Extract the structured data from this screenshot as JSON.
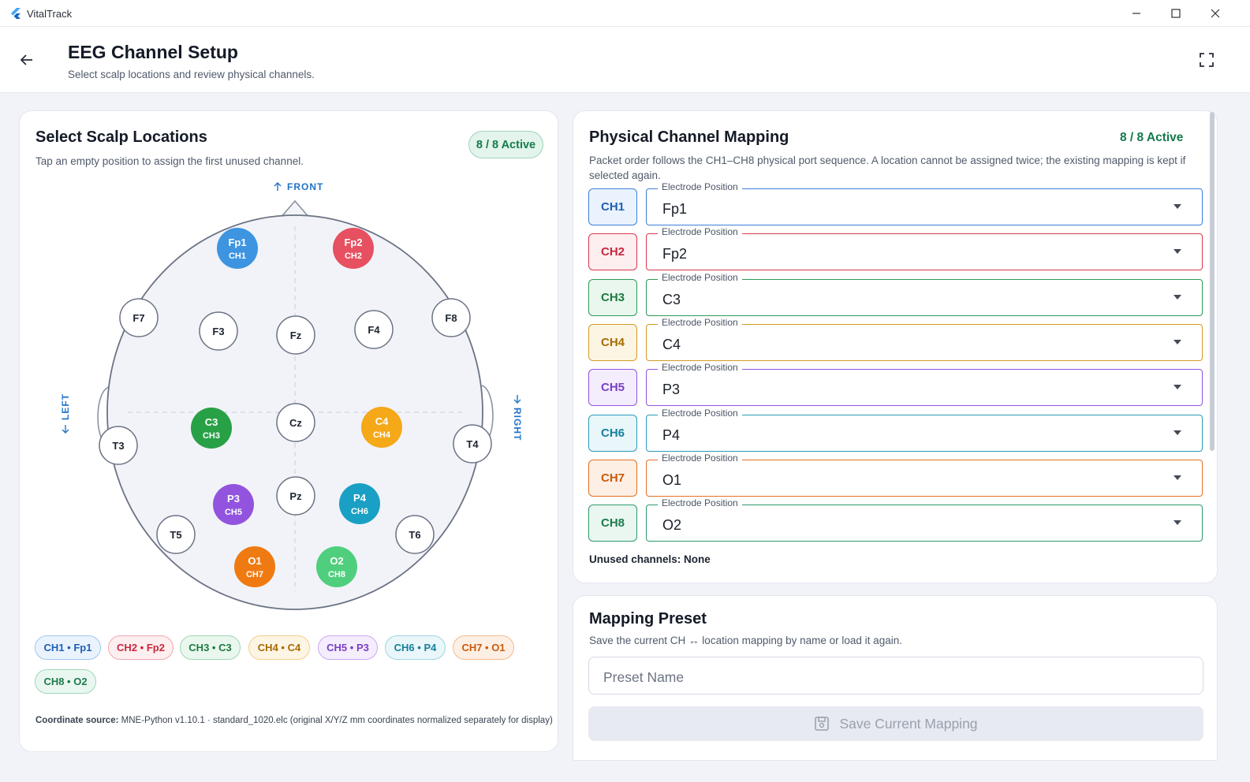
{
  "window": {
    "app_name": "VitalTrack"
  },
  "header": {
    "title": "EEG Channel Setup",
    "subtitle": "Select scalp locations and review physical channels."
  },
  "scalp": {
    "title": "Select Scalp Locations",
    "description": "Tap an empty position to assign the first unused channel.",
    "badge": "8 / 8 Active",
    "front_label": "FRONT",
    "left_label": "LEFT",
    "right_label": "RIGHT",
    "electrodes": [
      {
        "label": "Fp1",
        "channel": "CH1",
        "color": "#3d94e0"
      },
      {
        "label": "Fp2",
        "channel": "CH2",
        "color": "#e65060"
      },
      {
        "label": "F7",
        "channel": ""
      },
      {
        "label": "F3",
        "channel": ""
      },
      {
        "label": "Fz",
        "channel": ""
      },
      {
        "label": "F4",
        "channel": ""
      },
      {
        "label": "F8",
        "channel": ""
      },
      {
        "label": "T3",
        "channel": ""
      },
      {
        "label": "C3",
        "channel": "CH3",
        "color": "#27a046"
      },
      {
        "label": "Cz",
        "channel": ""
      },
      {
        "label": "C4",
        "channel": "CH4",
        "color": "#f5a818"
      },
      {
        "label": "T4",
        "channel": ""
      },
      {
        "label": "T5",
        "channel": ""
      },
      {
        "label": "P3",
        "channel": "CH5",
        "color": "#9254de"
      },
      {
        "label": "Pz",
        "channel": ""
      },
      {
        "label": "P4",
        "channel": "CH6",
        "color": "#1aa0c4"
      },
      {
        "label": "T6",
        "channel": ""
      },
      {
        "label": "O1",
        "channel": "CH7",
        "color": "#f07a12"
      },
      {
        "label": "O2",
        "channel": "CH8",
        "color": "#4fcf7d"
      }
    ],
    "chips": [
      {
        "text": "CH1 • Fp1",
        "fg": "#1f5fb4",
        "bg": "#eaf3fd",
        "border": "#9ec5ef"
      },
      {
        "text": "CH2 • Fp2",
        "fg": "#c8283d",
        "bg": "#fdeef0",
        "border": "#f0a7b1"
      },
      {
        "text": "CH3 • C3",
        "fg": "#1e7a40",
        "bg": "#eaf7ee",
        "border": "#9fd6b2"
      },
      {
        "text": "CH4 • C4",
        "fg": "#a86a00",
        "bg": "#fdf5e4",
        "border": "#f0cf8a"
      },
      {
        "text": "CH5 • P3",
        "fg": "#7a3fc6",
        "bg": "#f4edfd",
        "border": "#c9a9f0"
      },
      {
        "text": "CH6 • P4",
        "fg": "#17809c",
        "bg": "#e9f6fa",
        "border": "#9fd4e3"
      },
      {
        "text": "CH7 • O1",
        "fg": "#c95a0c",
        "bg": "#fdefe4",
        "border": "#f2bb90"
      },
      {
        "text": "CH8 • O2",
        "fg": "#1e7a4c",
        "bg": "#eaf7f0",
        "border": "#9fd6b8"
      }
    ],
    "coord_source_label": "Coordinate source:",
    "coord_source_text": "MNE-Python v1.10.1 · standard_1020.elc (original X/Y/Z mm coordinates normalized separately for display)"
  },
  "mapping": {
    "title": "Physical Channel Mapping",
    "badge": "8 / 8 Active",
    "description": "Packet order follows the CH1–CH8 physical port sequence. A location cannot be assigned twice; the existing mapping is kept if selected again.",
    "field_label": "Electrode Position",
    "rows": [
      {
        "channel": "CH1",
        "value": "Fp1",
        "color": "#3d7fd9",
        "tag_bg": "#eaf3fd",
        "tag_fg": "#1f5fb4"
      },
      {
        "channel": "CH2",
        "value": "Fp2",
        "color": "#d9364d",
        "tag_bg": "#fdeef0",
        "tag_fg": "#c8283d"
      },
      {
        "channel": "CH3",
        "value": "C3",
        "color": "#2c9a55",
        "tag_bg": "#eaf7ee",
        "tag_fg": "#1e7a40"
      },
      {
        "channel": "CH4",
        "value": "C4",
        "color": "#d49a22",
        "tag_bg": "#fdf5e4",
        "tag_fg": "#a86a00"
      },
      {
        "channel": "CH5",
        "value": "P3",
        "color": "#9254de",
        "tag_bg": "#f4edfd",
        "tag_fg": "#7a3fc6"
      },
      {
        "channel": "CH6",
        "value": "P4",
        "color": "#2a9cb8",
        "tag_bg": "#e9f6fa",
        "tag_fg": "#17809c"
      },
      {
        "channel": "CH7",
        "value": "O1",
        "color": "#e46f24",
        "tag_bg": "#fdefe4",
        "tag_fg": "#c95a0c"
      },
      {
        "channel": "CH8",
        "value": "O2",
        "color": "#2c9a6a",
        "tag_bg": "#eaf7f0",
        "tag_fg": "#1e7a4c"
      }
    ],
    "unused": "Unused channels: None"
  },
  "preset": {
    "title": "Mapping Preset",
    "description": "Save the current CH ↔ location mapping by name or load it again.",
    "input_placeholder": "Preset Name",
    "save_label": "Save Current Mapping"
  }
}
